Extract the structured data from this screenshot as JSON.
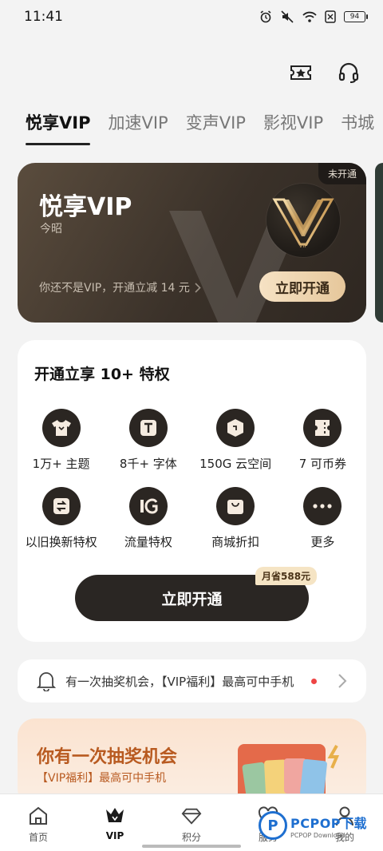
{
  "status_bar": {
    "time": "11:41",
    "battery": "94"
  },
  "header": {
    "actions": [
      "ticket-star-icon",
      "headset-icon"
    ]
  },
  "tabs": [
    {
      "label": "悦享VIP",
      "active": true
    },
    {
      "label": "加速VIP",
      "active": false
    },
    {
      "label": "变声VIP",
      "active": false
    },
    {
      "label": "影视VIP",
      "active": false
    },
    {
      "label": "书城",
      "active": false
    }
  ],
  "vip_card": {
    "status_tag": "未开通",
    "title": "悦享VIP",
    "user_name": "今昭",
    "promo_text": "你还不是VIP，开通立减 14 元",
    "logo_caption": "VIP",
    "open_button": "立即开通"
  },
  "perks": {
    "title": "开通立享 10+ 特权",
    "items": [
      {
        "label": "1万+ 主题",
        "icon": "tshirt-icon"
      },
      {
        "label": "8千+ 字体",
        "icon": "font-icon"
      },
      {
        "label": "150G 云空间",
        "icon": "cloud-box-icon"
      },
      {
        "label": "7 可币券",
        "icon": "coupon-icon"
      },
      {
        "label": "以旧换新特权",
        "icon": "trade-in-icon"
      },
      {
        "label": "流量特权",
        "icon": "data-1g-icon"
      },
      {
        "label": "商城折扣",
        "icon": "shop-bag-icon"
      },
      {
        "label": "更多",
        "icon": "more-icon"
      }
    ],
    "open_button": "立即开通",
    "save_badge": "月省588元"
  },
  "notice": {
    "text": "有一次抽奖机会，【VIP福利】最高可中手机"
  },
  "lottery": {
    "title": "你有一次抽奖机会",
    "subtitle": "【VIP福利】最高可中手机"
  },
  "bottom_nav": [
    {
      "label": "首页",
      "icon": "home-icon",
      "active": false
    },
    {
      "label": "VIP",
      "icon": "crown-icon",
      "active": true
    },
    {
      "label": "积分",
      "icon": "diamond-icon",
      "active": false
    },
    {
      "label": "服务",
      "icon": "heart-icon",
      "active": false
    },
    {
      "label": "我的",
      "icon": "person-icon",
      "active": false
    }
  ],
  "watermark": {
    "main": "PCPOP下载",
    "sub": "PCPOP Download"
  }
}
